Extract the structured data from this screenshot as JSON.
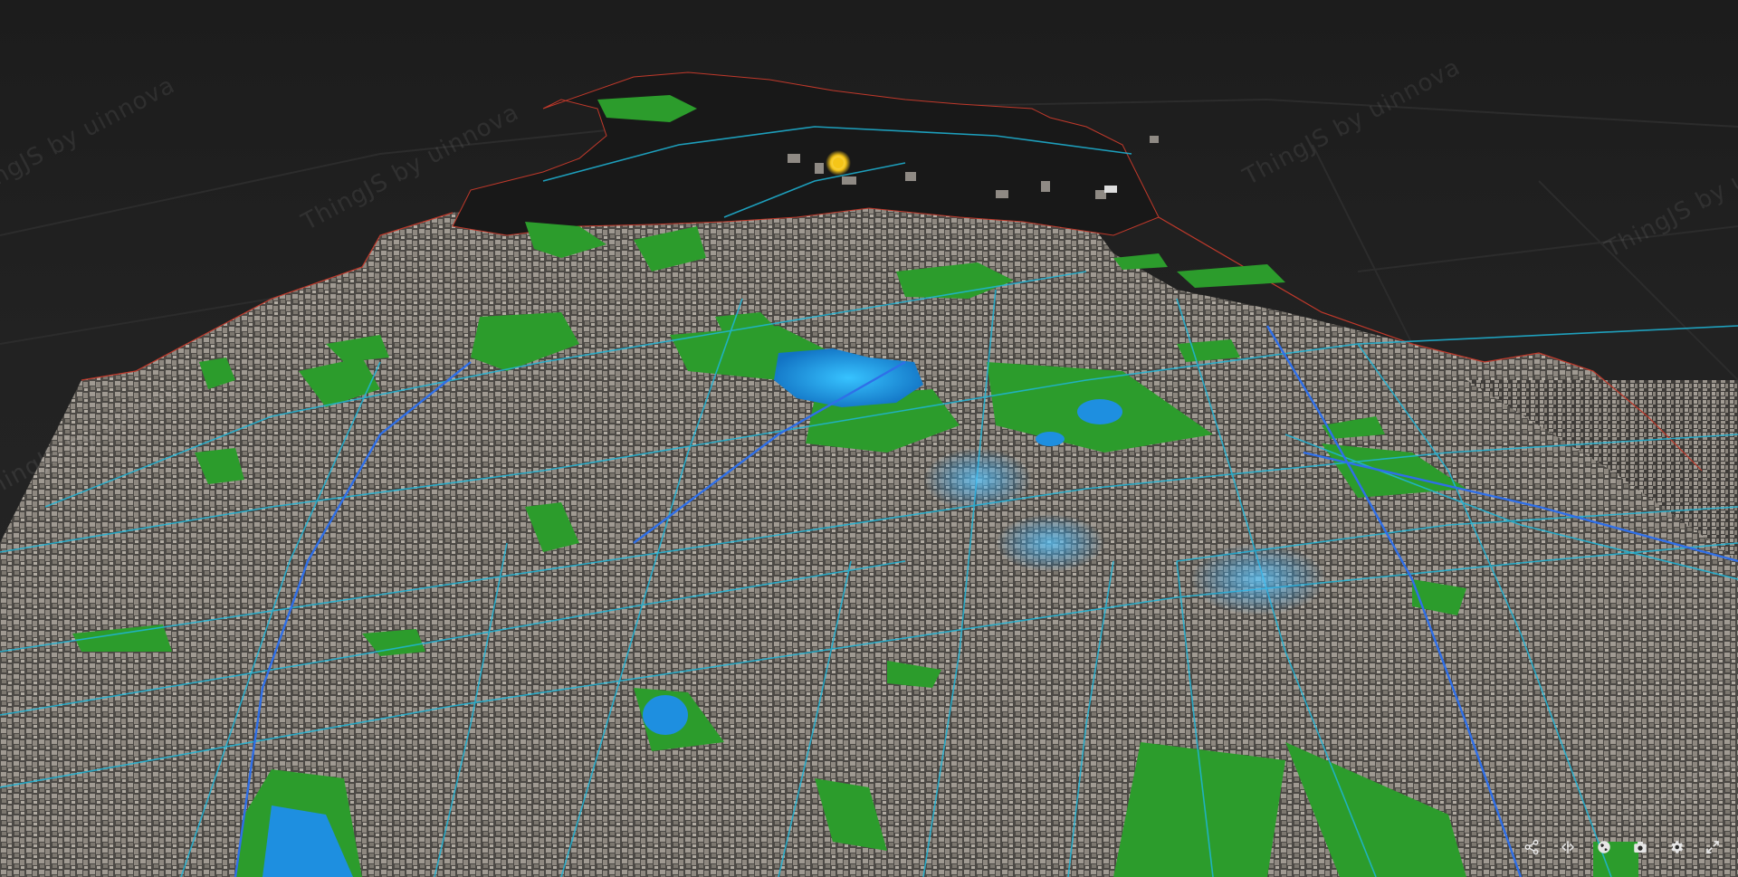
{
  "app": {
    "watermark_text": "ThingJS by uinnova"
  },
  "map": {
    "background_color": "#1e1e1e",
    "building_color": "#8f8a84",
    "park_color": "#2c9c2c",
    "water_color": "#1e8fe0",
    "road_color": "#1fb6d8",
    "major_road_color": "#2f6fe8",
    "boundary_color": "#c0392b",
    "sun_marker_color": "#f5c518",
    "heat_glow_color": "#3fb8ff"
  },
  "toolbar": {
    "icon_color": "#e6e6e6",
    "buttons": [
      {
        "icon": "share-icon"
      },
      {
        "icon": "camera-mode-icon"
      },
      {
        "icon": "globe-icon"
      },
      {
        "icon": "screenshot-icon"
      },
      {
        "icon": "gear-icon"
      },
      {
        "icon": "fullscreen-icon"
      }
    ]
  }
}
